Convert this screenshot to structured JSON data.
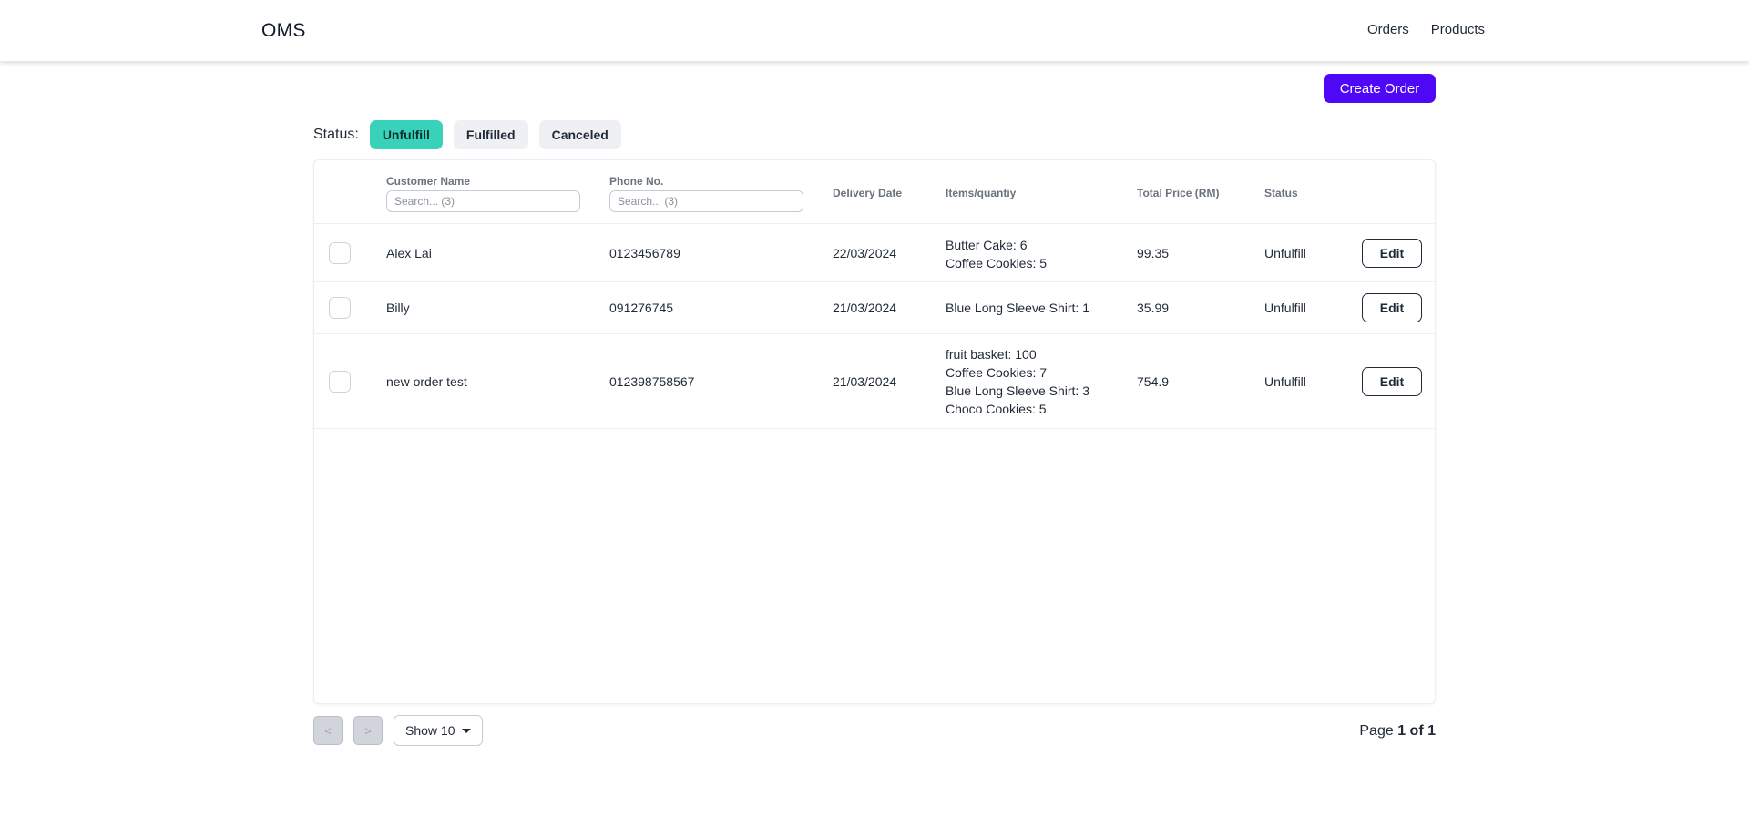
{
  "app": {
    "brand": "OMS"
  },
  "nav": {
    "orders": "Orders",
    "products": "Products"
  },
  "actions": {
    "create_order": "Create Order"
  },
  "status_filter": {
    "label": "Status:",
    "options": [
      "Unfulfill",
      "Fulfilled",
      "Canceled"
    ],
    "active": "Unfulfill"
  },
  "table": {
    "headers": {
      "customer_name": "Customer Name",
      "phone": "Phone No.",
      "delivery_date": "Delivery Date",
      "items": "Items/quantiy",
      "total_price": "Total Price (RM)",
      "status": "Status"
    },
    "search": {
      "customer_placeholder": "Search... (3)",
      "phone_placeholder": "Search... (3)"
    },
    "edit_label": "Edit",
    "rows": [
      {
        "name": "Alex Lai",
        "phone": "0123456789",
        "date": "22/03/2024",
        "items": [
          "Butter Cake: 6",
          "Coffee Cookies: 5"
        ],
        "total": "99.35",
        "status": "Unfulfill"
      },
      {
        "name": "Billy",
        "phone": "091276745",
        "date": "21/03/2024",
        "items": [
          "Blue Long Sleeve Shirt: 1"
        ],
        "total": "35.99",
        "status": "Unfulfill"
      },
      {
        "name": "new order test",
        "phone": "012398758567",
        "date": "21/03/2024",
        "items": [
          "fruit basket: 100",
          "Coffee Cookies: 7",
          "Blue Long Sleeve Shirt: 3",
          "Choco Cookies: 5"
        ],
        "total": "754.9",
        "status": "Unfulfill"
      }
    ]
  },
  "pagination": {
    "prev": "<",
    "next": ">",
    "show_label": "Show 10",
    "page_prefix": "Page",
    "page_current": "1 of 1"
  },
  "colors": {
    "primary": "#4f08f5",
    "active_chip": "#38d1b9"
  }
}
